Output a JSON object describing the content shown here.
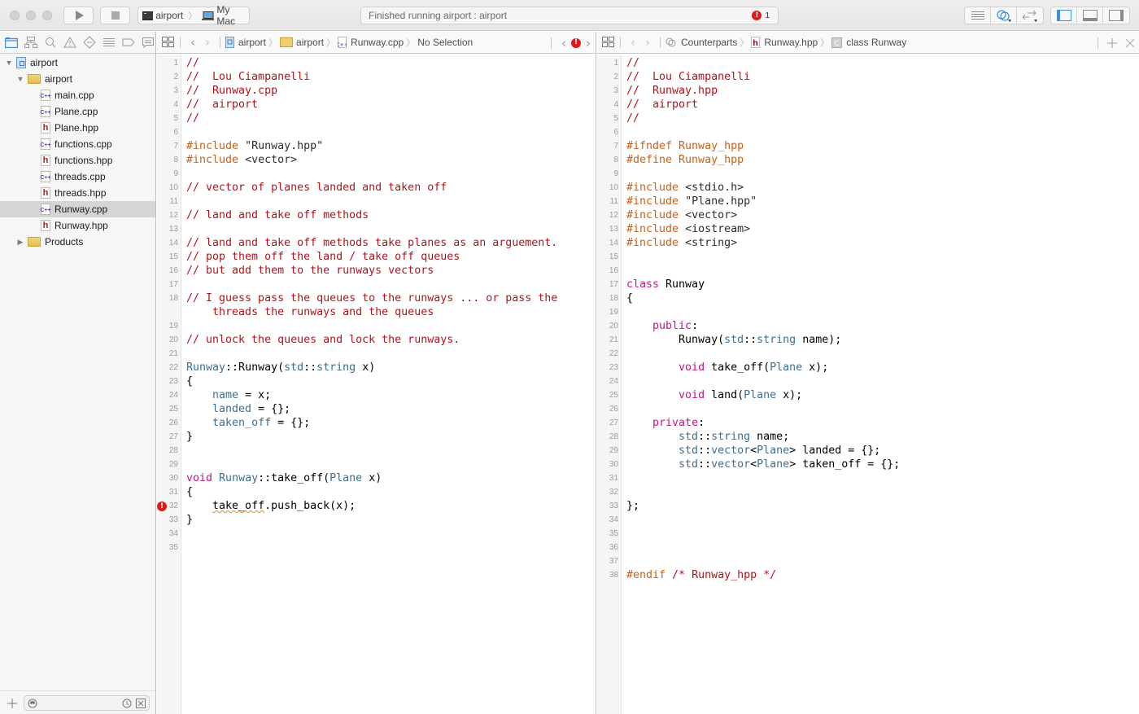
{
  "toolbar": {
    "scheme": "airport",
    "destination": "My Mac",
    "status_text": "Finished running airport : airport",
    "error_count": "1"
  },
  "navigator": {
    "tree": [
      {
        "label": "airport",
        "kind": "project",
        "level": 0,
        "expanded": true
      },
      {
        "label": "airport",
        "kind": "folder",
        "level": 1,
        "expanded": true
      },
      {
        "label": "main.cpp",
        "kind": "cpp",
        "level": 2
      },
      {
        "label": "Plane.cpp",
        "kind": "cpp",
        "level": 2
      },
      {
        "label": "Plane.hpp",
        "kind": "hpp",
        "level": 2
      },
      {
        "label": "functions.cpp",
        "kind": "cpp",
        "level": 2
      },
      {
        "label": "functions.hpp",
        "kind": "hpp",
        "level": 2
      },
      {
        "label": "threads.cpp",
        "kind": "cpp",
        "level": 2
      },
      {
        "label": "threads.hpp",
        "kind": "hpp",
        "level": 2
      },
      {
        "label": "Runway.cpp",
        "kind": "cpp",
        "level": 2,
        "selected": true
      },
      {
        "label": "Runway.hpp",
        "kind": "hpp",
        "level": 2
      },
      {
        "label": "Products",
        "kind": "folder",
        "level": 1,
        "expanded": false
      }
    ]
  },
  "left_editor": {
    "jumpbar": {
      "project": "airport",
      "group": "airport",
      "file": "Runway.cpp",
      "selection": "No Selection"
    },
    "lines": [
      {
        "n": "1",
        "tokens": [
          [
            "c-com",
            "//"
          ]
        ]
      },
      {
        "n": "2",
        "tokens": [
          [
            "c-com",
            "//  Lou Ciampanelli"
          ]
        ]
      },
      {
        "n": "3",
        "tokens": [
          [
            "c-com",
            "//  Runway.cpp"
          ]
        ]
      },
      {
        "n": "4",
        "tokens": [
          [
            "c-com",
            "//  airport"
          ]
        ]
      },
      {
        "n": "5",
        "tokens": [
          [
            "c-com",
            "//"
          ]
        ]
      },
      {
        "n": "6",
        "tokens": []
      },
      {
        "n": "7",
        "tokens": [
          [
            "c-pre",
            "#include "
          ],
          [
            "c-str",
            "\"Runway.hpp\""
          ]
        ]
      },
      {
        "n": "8",
        "tokens": [
          [
            "c-pre",
            "#include "
          ],
          [
            "c-str",
            "<vector>"
          ]
        ]
      },
      {
        "n": "9",
        "tokens": []
      },
      {
        "n": "10",
        "tokens": [
          [
            "c-com",
            "// vector of planes landed and taken off"
          ]
        ]
      },
      {
        "n": "11",
        "tokens": []
      },
      {
        "n": "12",
        "tokens": [
          [
            "c-com",
            "// land and take off methods"
          ]
        ]
      },
      {
        "n": "13",
        "tokens": []
      },
      {
        "n": "14",
        "tokens": [
          [
            "c-com",
            "// land and take off methods take planes as an arguement."
          ]
        ]
      },
      {
        "n": "15",
        "tokens": [
          [
            "c-com",
            "// pop them off the land / take off queues"
          ]
        ]
      },
      {
        "n": "16",
        "tokens": [
          [
            "c-com",
            "// but add them to the runways vectors"
          ]
        ]
      },
      {
        "n": "17",
        "tokens": []
      },
      {
        "n": "18",
        "tokens": [
          [
            "c-com",
            "// I guess pass the queues to the runways ... or pass the"
          ]
        ]
      },
      {
        "n": "",
        "tokens": [
          [
            "c-com",
            "    threads the runways and the queues"
          ]
        ]
      },
      {
        "n": "19",
        "tokens": []
      },
      {
        "n": "20",
        "tokens": [
          [
            "c-com",
            "// unlock the queues and lock the runways."
          ]
        ]
      },
      {
        "n": "21",
        "tokens": []
      },
      {
        "n": "22",
        "tokens": [
          [
            "c-type",
            "Runway"
          ],
          [
            "c-plain",
            "::Runway("
          ],
          [
            "c-type",
            "std"
          ],
          [
            "c-plain",
            "::"
          ],
          [
            "c-type",
            "string"
          ],
          [
            "c-plain",
            " x)"
          ]
        ]
      },
      {
        "n": "23",
        "tokens": [
          [
            "c-plain",
            "{"
          ]
        ]
      },
      {
        "n": "24",
        "tokens": [
          [
            "c-plain",
            "    "
          ],
          [
            "c-type",
            "name"
          ],
          [
            "c-plain",
            " = x;"
          ]
        ]
      },
      {
        "n": "25",
        "tokens": [
          [
            "c-plain",
            "    "
          ],
          [
            "c-type",
            "landed"
          ],
          [
            "c-plain",
            " = {};"
          ]
        ]
      },
      {
        "n": "26",
        "tokens": [
          [
            "c-plain",
            "    "
          ],
          [
            "c-type",
            "taken_off"
          ],
          [
            "c-plain",
            " = {};"
          ]
        ]
      },
      {
        "n": "27",
        "tokens": [
          [
            "c-plain",
            "}"
          ]
        ]
      },
      {
        "n": "28",
        "tokens": []
      },
      {
        "n": "29",
        "tokens": []
      },
      {
        "n": "30",
        "tokens": [
          [
            "c-kw",
            "void"
          ],
          [
            "c-plain",
            " "
          ],
          [
            "c-type",
            "Runway"
          ],
          [
            "c-plain",
            "::take_off("
          ],
          [
            "c-type",
            "Plane"
          ],
          [
            "c-plain",
            " x)"
          ]
        ]
      },
      {
        "n": "31",
        "tokens": [
          [
            "c-plain",
            "{"
          ]
        ]
      },
      {
        "n": "32",
        "error": true,
        "tokens": [
          [
            "c-plain",
            "    "
          ],
          [
            "c-plain squiggle",
            "take_off"
          ],
          [
            "c-plain",
            ".push_back(x);"
          ]
        ]
      },
      {
        "n": "33",
        "tokens": [
          [
            "c-plain",
            "}"
          ]
        ]
      },
      {
        "n": "34",
        "tokens": []
      },
      {
        "n": "35",
        "tokens": []
      }
    ]
  },
  "right_editor": {
    "jumpbar": {
      "mode": "Counterparts",
      "file": "Runway.hpp",
      "symbol": "class Runway"
    },
    "lines": [
      {
        "n": "1",
        "tokens": [
          [
            "c-com",
            "//"
          ]
        ]
      },
      {
        "n": "2",
        "tokens": [
          [
            "c-com",
            "//  Lou Ciampanelli"
          ]
        ]
      },
      {
        "n": "3",
        "tokens": [
          [
            "c-com",
            "//  Runway.hpp"
          ]
        ]
      },
      {
        "n": "4",
        "tokens": [
          [
            "c-com",
            "//  airport"
          ]
        ]
      },
      {
        "n": "5",
        "tokens": [
          [
            "c-com",
            "//"
          ]
        ]
      },
      {
        "n": "6",
        "tokens": []
      },
      {
        "n": "7",
        "tokens": [
          [
            "c-pre",
            "#ifndef Runway_hpp"
          ]
        ]
      },
      {
        "n": "8",
        "tokens": [
          [
            "c-pre",
            "#define Runway_hpp"
          ]
        ]
      },
      {
        "n": "9",
        "tokens": []
      },
      {
        "n": "10",
        "tokens": [
          [
            "c-pre",
            "#include "
          ],
          [
            "c-str",
            "<stdio.h>"
          ]
        ]
      },
      {
        "n": "11",
        "tokens": [
          [
            "c-pre",
            "#include "
          ],
          [
            "c-str",
            "\"Plane.hpp\""
          ]
        ]
      },
      {
        "n": "12",
        "tokens": [
          [
            "c-pre",
            "#include "
          ],
          [
            "c-str",
            "<vector>"
          ]
        ]
      },
      {
        "n": "13",
        "tokens": [
          [
            "c-pre",
            "#include "
          ],
          [
            "c-str",
            "<iostream>"
          ]
        ]
      },
      {
        "n": "14",
        "tokens": [
          [
            "c-pre",
            "#include "
          ],
          [
            "c-str",
            "<string>"
          ]
        ]
      },
      {
        "n": "15",
        "tokens": []
      },
      {
        "n": "16",
        "tokens": []
      },
      {
        "n": "17",
        "tokens": [
          [
            "c-kw",
            "class"
          ],
          [
            "c-plain",
            " Runway"
          ]
        ]
      },
      {
        "n": "18",
        "tokens": [
          [
            "c-plain",
            "{"
          ]
        ]
      },
      {
        "n": "19",
        "tokens": []
      },
      {
        "n": "20",
        "tokens": [
          [
            "c-plain",
            "    "
          ],
          [
            "c-kw",
            "public"
          ],
          [
            "c-plain",
            ":"
          ]
        ]
      },
      {
        "n": "21",
        "tokens": [
          [
            "c-plain",
            "        Runway("
          ],
          [
            "c-type",
            "std"
          ],
          [
            "c-plain",
            "::"
          ],
          [
            "c-type",
            "string"
          ],
          [
            "c-plain",
            " name);"
          ]
        ]
      },
      {
        "n": "22",
        "tokens": []
      },
      {
        "n": "23",
        "tokens": [
          [
            "c-plain",
            "        "
          ],
          [
            "c-kw",
            "void"
          ],
          [
            "c-plain",
            " take_off("
          ],
          [
            "c-type",
            "Plane"
          ],
          [
            "c-plain",
            " x);"
          ]
        ]
      },
      {
        "n": "24",
        "tokens": []
      },
      {
        "n": "25",
        "tokens": [
          [
            "c-plain",
            "        "
          ],
          [
            "c-kw",
            "void"
          ],
          [
            "c-plain",
            " land("
          ],
          [
            "c-type",
            "Plane"
          ],
          [
            "c-plain",
            " x);"
          ]
        ]
      },
      {
        "n": "26",
        "tokens": []
      },
      {
        "n": "27",
        "tokens": [
          [
            "c-plain",
            "    "
          ],
          [
            "c-kw",
            "private"
          ],
          [
            "c-plain",
            ":"
          ]
        ]
      },
      {
        "n": "28",
        "tokens": [
          [
            "c-plain",
            "        "
          ],
          [
            "c-type",
            "std"
          ],
          [
            "c-plain",
            "::"
          ],
          [
            "c-type",
            "string"
          ],
          [
            "c-plain",
            " name;"
          ]
        ]
      },
      {
        "n": "29",
        "tokens": [
          [
            "c-plain",
            "        "
          ],
          [
            "c-type",
            "std"
          ],
          [
            "c-plain",
            "::"
          ],
          [
            "c-type",
            "vector"
          ],
          [
            "c-plain",
            "<"
          ],
          [
            "c-type",
            "Plane"
          ],
          [
            "c-plain",
            "> landed = {};"
          ]
        ]
      },
      {
        "n": "30",
        "tokens": [
          [
            "c-plain",
            "        "
          ],
          [
            "c-type",
            "std"
          ],
          [
            "c-plain",
            "::"
          ],
          [
            "c-type",
            "vector"
          ],
          [
            "c-plain",
            "<"
          ],
          [
            "c-type",
            "Plane"
          ],
          [
            "c-plain",
            "> taken_off = {};"
          ]
        ]
      },
      {
        "n": "31",
        "tokens": []
      },
      {
        "n": "32",
        "tokens": []
      },
      {
        "n": "33",
        "tokens": [
          [
            "c-plain",
            "};"
          ]
        ]
      },
      {
        "n": "34",
        "tokens": []
      },
      {
        "n": "35",
        "tokens": []
      },
      {
        "n": "36",
        "tokens": []
      },
      {
        "n": "37",
        "tokens": []
      },
      {
        "n": "38",
        "tokens": [
          [
            "c-pre",
            "#endif "
          ],
          [
            "c-com",
            "/* Runway_hpp */"
          ]
        ]
      }
    ]
  },
  "colors": {
    "comment": "#b0141b",
    "preprocessor": "#c7601b",
    "keyword": "#c1177e",
    "type": "#3f6e8f",
    "error": "#dc1b1b",
    "selection": "#d5d5d5"
  }
}
